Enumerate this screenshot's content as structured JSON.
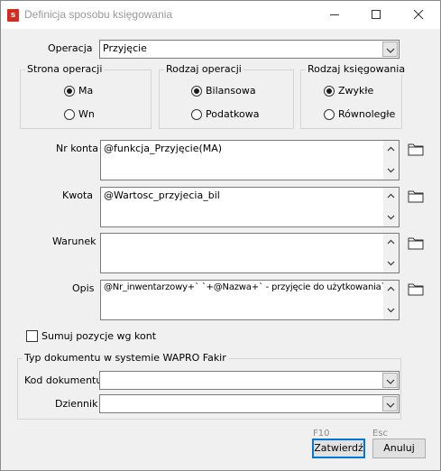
{
  "window": {
    "title": "Definicja sposobu księgowania",
    "icon_letter": "s"
  },
  "operacja": {
    "label": "Operacja",
    "value": "Przyjęcie"
  },
  "strona_operacji": {
    "title": "Strona operacji",
    "options": [
      {
        "label": "Ma",
        "selected": true
      },
      {
        "label": "Wn",
        "selected": false
      }
    ]
  },
  "rodzaj_operacji": {
    "title": "Rodzaj operacji",
    "options": [
      {
        "label": "Bilansowa",
        "selected": true
      },
      {
        "label": "Podatkowa",
        "selected": false
      }
    ]
  },
  "rodzaj_ksiegowania": {
    "title": "Rodzaj księgowania",
    "options": [
      {
        "label": "Zwykłe",
        "selected": true
      },
      {
        "label": "Równoległe",
        "selected": false
      }
    ]
  },
  "fields": {
    "nr_konta": {
      "label": "Nr konta",
      "value": "@funkcja_Przyjęcie(MA)"
    },
    "kwota": {
      "label": "Kwota",
      "value": "@Wartosc_przyjecia_bil"
    },
    "warunek": {
      "label": "Warunek",
      "value": ""
    },
    "opis": {
      "label": "Opis",
      "value": "@Nr_inwentarzowy+` `+@Nazwa+` - przyjęcie do użytkowania`"
    }
  },
  "sumuj": {
    "label": "Sumuj pozycje wg kont",
    "checked": false
  },
  "typ_dokumentu": {
    "title": "Typ dokumentu w systemie WAPRO Fakir",
    "kod_label": "Kod dokumentu",
    "kod_value": "",
    "dziennik_label": "Dziennik",
    "dziennik_value": ""
  },
  "buttons": {
    "confirm_hint": "F10",
    "confirm_label": "Zatwierdź",
    "cancel_hint": "Esc",
    "cancel_label": "Anuluj"
  },
  "colors": {
    "accent": "#0078d7",
    "app_icon": "#d62b1f"
  },
  "icons": {
    "folder": "folder-icon",
    "dropdown": "chevron-down-icon"
  }
}
